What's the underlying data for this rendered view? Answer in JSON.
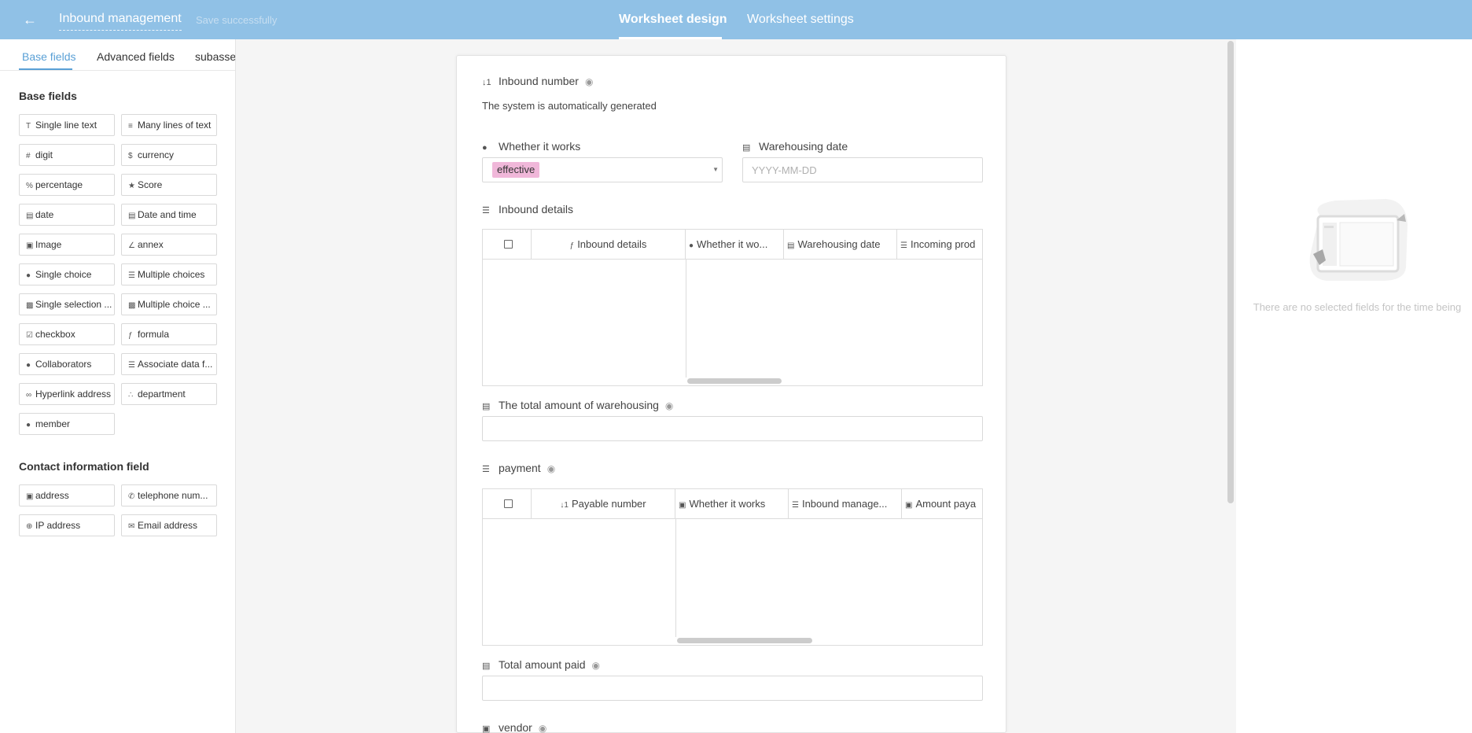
{
  "header": {
    "back_icon": "arrow-left-icon",
    "title": "Inbound management",
    "save_status": "Save successfully",
    "tabs": [
      "Worksheet design",
      "Worksheet settings"
    ],
    "active_tab": "Worksheet design"
  },
  "left_panel": {
    "tabs": [
      "Base fields",
      "Advanced fields",
      "subassembly"
    ],
    "active_tab": "Base fields",
    "sections": [
      {
        "title": "Base fields",
        "fields": [
          {
            "label": "Single line text",
            "icon": "text-icon"
          },
          {
            "label": "Many lines of text",
            "icon": "multiline-text-icon"
          },
          {
            "label": "digit",
            "icon": "hash-icon"
          },
          {
            "label": "currency",
            "icon": "dollar-icon"
          },
          {
            "label": "percentage",
            "icon": "percent-icon"
          },
          {
            "label": "Score",
            "icon": "star-icon"
          },
          {
            "label": "date",
            "icon": "calendar-icon"
          },
          {
            "label": "Date and time",
            "icon": "calendar-clock-icon"
          },
          {
            "label": "Image",
            "icon": "image-icon"
          },
          {
            "label": "annex",
            "icon": "paperclip-icon"
          },
          {
            "label": "Single choice",
            "icon": "radio-icon"
          },
          {
            "label": "Multiple choices",
            "icon": "checklist-icon"
          },
          {
            "label": "Single selection ...",
            "icon": "single-select-icon"
          },
          {
            "label": "Multiple choice ...",
            "icon": "multi-select-icon"
          },
          {
            "label": "checkbox",
            "icon": "checkbox-icon"
          },
          {
            "label": "formula",
            "icon": "formula-icon"
          },
          {
            "label": "Collaborators",
            "icon": "users-icon"
          },
          {
            "label": "Associate data f...",
            "icon": "link-data-icon"
          },
          {
            "label": "Hyperlink address",
            "icon": "hyperlink-icon"
          },
          {
            "label": "department",
            "icon": "org-chart-icon"
          },
          {
            "label": "member",
            "icon": "users-icon"
          }
        ]
      },
      {
        "title": "Contact information field",
        "fields": [
          {
            "label": "address",
            "icon": "address-icon"
          },
          {
            "label": "telephone num...",
            "icon": "phone-icon"
          },
          {
            "label": "IP address",
            "icon": "globe-icon"
          },
          {
            "label": "Email address",
            "icon": "mail-icon"
          }
        ]
      }
    ]
  },
  "form": {
    "inbound_number": {
      "label": "Inbound number",
      "icon": "sort-number-icon",
      "note": "The system is automatically generated"
    },
    "whether_it_works": {
      "label": "Whether it works",
      "icon": "radio-icon",
      "value": "effective",
      "tag_color": "#f0b7d9"
    },
    "warehousing_date": {
      "label": "Warehousing date",
      "icon": "calendar-icon",
      "placeholder": "YYYY-MM-DD"
    },
    "inbound_details": {
      "label": "Inbound details",
      "icon": "subtable-icon",
      "columns": [
        {
          "label": "Inbound details",
          "icon": "formula-icon"
        },
        {
          "label": "Whether it wo...",
          "icon": "radio-icon"
        },
        {
          "label": "Warehousing date",
          "icon": "calendar-icon"
        },
        {
          "label": "Incoming prod",
          "icon": "subtable-icon"
        }
      ]
    },
    "total_warehousing": {
      "label": "The total amount of warehousing",
      "icon": "summary-icon"
    },
    "payment": {
      "label": "payment",
      "icon": "subtable-icon",
      "columns": [
        {
          "label": "Payable number",
          "icon": "sort-number-icon"
        },
        {
          "label": "Whether it works",
          "icon": "lookup-icon"
        },
        {
          "label": "Inbound manage...",
          "icon": "subtable-icon"
        },
        {
          "label": "Amount paya",
          "icon": "lookup-icon"
        }
      ]
    },
    "total_paid": {
      "label": "Total amount paid",
      "icon": "summary-icon"
    },
    "vendor": {
      "label": "vendor",
      "icon": "lookup-icon"
    }
  },
  "right_panel": {
    "empty_text": "There are no selected fields for the time being"
  },
  "colors": {
    "header_bg": "#90c1e6",
    "accent": "#5aa0d6"
  }
}
